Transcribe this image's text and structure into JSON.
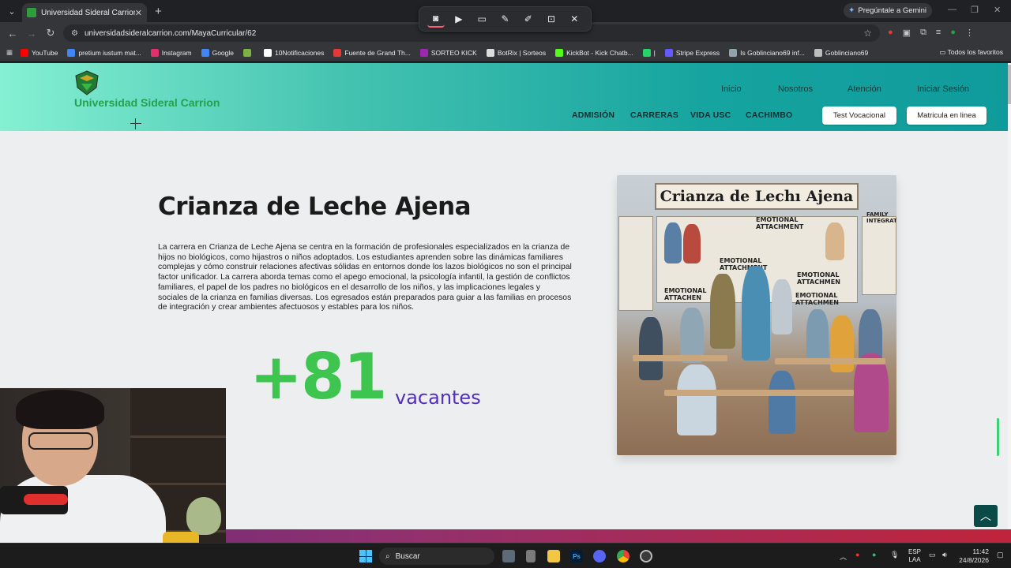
{
  "browser": {
    "tab_title": "Universidad Sideral Carrion",
    "url": "universidadsideralcarrion.com/MayaCurricular/62",
    "gemini_button": "Pregúntale a Gemini",
    "bookmarks": [
      {
        "label": "YouTube",
        "color": "#ff0000"
      },
      {
        "label": "pretium iustum mat...",
        "color": "#4285f4"
      },
      {
        "label": "Instagram",
        "color": "#e1306c"
      },
      {
        "label": "Google",
        "color": "#4285f4"
      },
      {
        "label": "",
        "color": "#7cb342"
      },
      {
        "label": "10Notificaciones",
        "color": "#ffffff"
      },
      {
        "label": "Fuente de Grand Th...",
        "color": "#e53935"
      },
      {
        "label": "SORTEO KICK",
        "color": "#9c27b0"
      },
      {
        "label": "BotRix | Sorteos",
        "color": "#dddddd"
      },
      {
        "label": "KickBot - Kick Chatb...",
        "color": "#53fc18"
      },
      {
        "label": "|",
        "color": "#25d366"
      },
      {
        "label": "Stripe Express",
        "color": "#635bff"
      },
      {
        "label": "Is Goblinciano69 inf...",
        "color": "#90a4ae"
      },
      {
        "label": "Goblinciano69",
        "color": "#bdbdbd"
      }
    ],
    "all_bookmarks": "Todos los favoritos"
  },
  "site": {
    "logo_text": "Universidad Sideral Carrion",
    "top_nav": [
      "Inicio",
      "Nosotros",
      "Atención",
      "Iniciar Sesión"
    ],
    "main_nav": [
      "ADMISIÓN",
      "CARRERAS",
      "VIDA USC",
      "CACHIMBO"
    ],
    "btn_test": "Test Vocacional",
    "btn_enroll": "Matricula en linea",
    "brand_green": "#24a14d"
  },
  "career": {
    "title": "Crianza de Leche Ajena",
    "description": "La carrera en Crianza de Leche Ajena se centra en la formación de profesionales especializados en la crianza de hijos no biológicos, como hijastros o niños adoptados. Los estudiantes aprenden sobre las dinámicas familiares complejas y cómo construir relaciones afectivas sólidas en entornos donde los lazos biológicos no son el principal factor unificador. La carrera aborda temas como el apego emocional, la psicología infantil, la gestión de conflictos familiares, el papel de los padres no biológicos en el desarrollo de los niños, y las implicaciones legales y sociales de la crianza en familias diversas. Los egresados están preparados para guiar a las familias en procesos de integración y crear ambientes afectuosos y estables para los niños.",
    "vacancies_number": "+81",
    "vacancies_label": "vacantes",
    "image_title": "Crianza de Lechı Ajena",
    "image_notes": [
      "EMOTIONAL ATTACHMENT",
      "EMOTIONAL ATTACHMENT",
      "EMOTIONAL ATTACHEN",
      "EMOTIONAL ATTACHMEN",
      "EMOTIONAL ATTACHMEN",
      "FAMILY INTEGRATIO"
    ],
    "number_color": "#3dc54f",
    "label_color": "#5330b8"
  },
  "taskbar": {
    "search_placeholder": "Buscar",
    "lang": "ESP",
    "lang_sub": "LAA",
    "time": "11:42",
    "date": "24/8/2026"
  }
}
